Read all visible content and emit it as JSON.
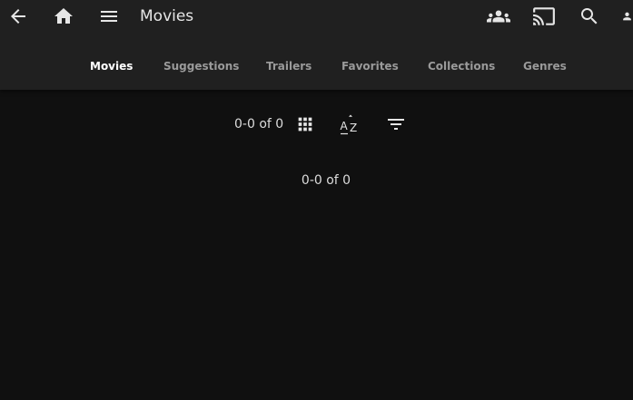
{
  "header": {
    "title": "Movies",
    "icons": {
      "back": "arrow-back-icon",
      "home": "home-icon",
      "menu": "menu-icon",
      "syncplay": "group-icon",
      "cast": "cast-icon",
      "search": "search-icon",
      "user": "person-icon"
    }
  },
  "tabs": [
    {
      "label": "Movies",
      "active": true
    },
    {
      "label": "Suggestions",
      "active": false
    },
    {
      "label": "Trailers",
      "active": false
    },
    {
      "label": "Favorites",
      "active": false
    },
    {
      "label": "Collections",
      "active": false
    },
    {
      "label": "Genres",
      "active": false
    }
  ],
  "toolbar": {
    "count_text": "0-0 of 0",
    "icons": {
      "view": "view-grid-icon",
      "sort": "sort-az-icon",
      "filter": "filter-icon"
    }
  },
  "content": {
    "count_text": "0-0 of 0"
  },
  "colors": {
    "background": "#101010",
    "header": "#202020",
    "active_tab": "#ffffff",
    "inactive_tab": "#9a9a9a"
  }
}
